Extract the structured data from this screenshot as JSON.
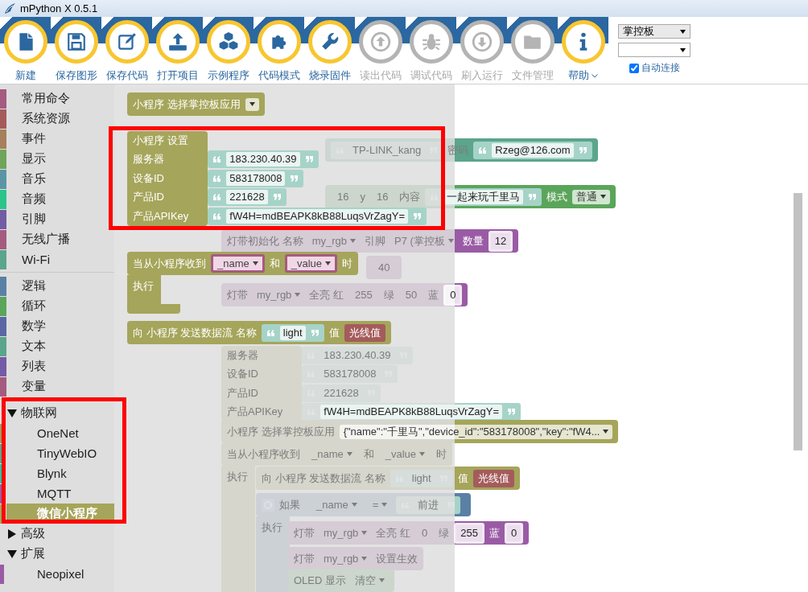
{
  "window": {
    "title": "mPython X 0.5.1"
  },
  "toolbar": {
    "buttons": [
      {
        "label": "新建",
        "disabled": false
      },
      {
        "label": "保存图形",
        "disabled": false
      },
      {
        "label": "保存代码",
        "disabled": false
      },
      {
        "label": "打开项目",
        "disabled": false
      },
      {
        "label": "示例程序",
        "disabled": false
      },
      {
        "label": "代码模式",
        "disabled": false
      },
      {
        "label": "烧录固件",
        "disabled": false
      },
      {
        "label": "读出代码",
        "disabled": true
      },
      {
        "label": "调试代码",
        "disabled": true
      },
      {
        "label": "刷入运行",
        "disabled": true
      },
      {
        "label": "文件管理",
        "disabled": true
      },
      {
        "label": "帮助",
        "disabled": false,
        "menu": true
      }
    ],
    "board_select": {
      "value": "掌控板"
    },
    "auto_connect": {
      "label": "自动连接",
      "checked": true
    }
  },
  "toolbox": {
    "sections": [
      {
        "items": [
          {
            "label": "常用命令",
            "color": "#a55b80",
            "selected": false
          },
          {
            "label": "系统资源",
            "color": "#a55b5b",
            "selected": false
          },
          {
            "label": "事件",
            "color": "#a5805b",
            "selected": false
          },
          {
            "label": "显示",
            "color": "#6fa55b",
            "selected": false
          },
          {
            "label": "音乐",
            "color": "#5b95a5",
            "selected": false
          },
          {
            "label": "音频",
            "color": "#2bc48a",
            "selected": false
          },
          {
            "label": "引脚",
            "color": "#745ba5",
            "selected": false
          },
          {
            "label": "无线广播",
            "color": "#a55b80",
            "selected": false
          },
          {
            "label": "Wi-Fi",
            "color": "#5ba58c",
            "selected": false
          }
        ]
      },
      {
        "items": [
          {
            "label": "逻辑",
            "color": "#5b80a5",
            "selected": false
          },
          {
            "label": "循环",
            "color": "#5ba55b",
            "selected": false
          },
          {
            "label": "数学",
            "color": "#5b67a5",
            "selected": false
          },
          {
            "label": "文本",
            "color": "#5ba58c",
            "selected": false
          },
          {
            "label": "列表",
            "color": "#745ba5",
            "selected": false
          },
          {
            "label": "变量",
            "color": "#a55b80",
            "selected": false
          }
        ]
      }
    ],
    "tree": [
      {
        "label": "物联网",
        "expanded": true,
        "highlighted": true,
        "children": [
          {
            "label": "OneNet",
            "color": "#a5985b",
            "selected": false
          },
          {
            "label": "TinyWebIO",
            "color": "#5ba58c",
            "selected": false
          },
          {
            "label": "Blynk",
            "color": "#2bc4a0",
            "selected": false
          },
          {
            "label": "MQTT",
            "color": "#9a5ba5",
            "selected": false
          },
          {
            "label": "微信小程序",
            "color": "#a5a55b",
            "selected": true
          }
        ]
      },
      {
        "label": "高级",
        "expanded": false,
        "highlighted": false
      },
      {
        "label": "扩展",
        "expanded": true,
        "highlighted": false,
        "children": [
          {
            "label": "Neopixel",
            "color": "#9a5ba5",
            "selected": false
          }
        ]
      }
    ]
  },
  "flyout": {
    "blocks": [
      {
        "kind": "iot",
        "rows": [
          [
            {
              "kind": "label",
              "text": "小程序 选择掌控板应用"
            },
            {
              "kind": "dropdown"
            }
          ]
        ]
      },
      {
        "kind": "iot_settings",
        "highlighted": true,
        "rows": [
          [
            {
              "kind": "label",
              "text": "小程序 设置"
            }
          ],
          [
            {
              "kind": "label",
              "text": "服务器"
            },
            {
              "kind": "string",
              "text": "183.230.40.39"
            }
          ],
          [
            {
              "kind": "label",
              "text": "设备ID"
            },
            {
              "kind": "string",
              "text": "583178008"
            }
          ],
          [
            {
              "kind": "label",
              "text": "产品ID"
            },
            {
              "kind": "string",
              "text": "221628"
            }
          ],
          [
            {
              "kind": "label",
              "text": "产品APIKey"
            },
            {
              "kind": "string",
              "text": "fW4H=mdBEAPK8kB88LuqsVrZagY="
            }
          ]
        ]
      },
      {
        "kind": "iot",
        "highlighted": false,
        "rows": [
          [
            {
              "kind": "label",
              "text": "当从小程序收到"
            },
            {
              "kind": "variable",
              "text": "_name"
            },
            {
              "kind": "label",
              "text": "和"
            },
            {
              "kind": "variable",
              "text": "_value"
            },
            {
              "kind": "label",
              "text": "时"
            }
          ],
          [
            {
              "kind": "label",
              "text": "执行"
            },
            {
              "kind": "statement"
            }
          ]
        ]
      },
      {
        "kind": "iot",
        "highlighted": false,
        "rows": [
          [
            {
              "kind": "label",
              "text": "向 小程序 发送数据流 名称"
            },
            {
              "kind": "string",
              "text": "light"
            },
            {
              "kind": "label",
              "text": "值"
            },
            {
              "kind": "sensor_block",
              "parts": [
                {
                  "kind": "label",
                  "text": "光线值"
                }
              ]
            }
          ]
        ]
      }
    ]
  },
  "workspace": {
    "blocks": [
      {
        "kind": "wifi",
        "rows": [
          [
            {
              "kind": "string",
              "text": "TP-LINK_kang"
            },
            {
              "kind": "label",
              "text": "密码"
            },
            {
              "kind": "string",
              "text": "Rzeg@126.com"
            }
          ]
        ]
      },
      {
        "kind": "display",
        "rows": [
          [
            {
              "kind": "number",
              "text": "16"
            },
            {
              "kind": "label",
              "text": "y"
            },
            {
              "kind": "number",
              "text": "16"
            },
            {
              "kind": "label",
              "text": "内容"
            },
            {
              "kind": "string",
              "text": "一起来玩千里马"
            },
            {
              "kind": "label",
              "text": "模式"
            },
            {
              "kind": "dropdown",
              "text": "普通"
            }
          ]
        ]
      },
      {
        "kind": "rgb",
        "rows": [
          [
            {
              "kind": "label",
              "text": "灯带初始化 名称"
            },
            {
              "kind": "dropdown",
              "text": "my_rgb"
            },
            {
              "kind": "label",
              "text": "引脚"
            },
            {
              "kind": "dropdown",
              "text": "P7 (掌控板"
            },
            {
              "kind": "label",
              "text": "数量"
            },
            {
              "kind": "number",
              "text": "12"
            }
          ]
        ]
      },
      {
        "kind": "rgb",
        "rows": [
          [
            {
              "kind": "number",
              "text": "40"
            }
          ]
        ]
      },
      {
        "kind": "rgb",
        "rows": [
          [
            {
              "kind": "label",
              "text": "灯带"
            },
            {
              "kind": "dropdown",
              "text": "my_rgb"
            },
            {
              "kind": "label",
              "text": "全亮 红"
            },
            {
              "kind": "number",
              "text": "255"
            },
            {
              "kind": "label",
              "text": "绿"
            },
            {
              "kind": "number",
              "text": "50"
            },
            {
              "kind": "label",
              "text": "蓝"
            },
            {
              "kind": "number",
              "text": "0"
            }
          ]
        ]
      },
      {
        "kind": "iot_settings",
        "rows": [
          [
            {
              "kind": "label",
              "text": "服务器"
            },
            {
              "kind": "string",
              "text": "183.230.40.39"
            }
          ],
          [
            {
              "kind": "label",
              "text": "设备ID"
            },
            {
              "kind": "string",
              "text": "583178008"
            }
          ],
          [
            {
              "kind": "label",
              "text": "产品ID"
            },
            {
              "kind": "string",
              "text": "221628"
            }
          ],
          [
            {
              "kind": "label",
              "text": "产品APIKey"
            },
            {
              "kind": "string",
              "text": "fW4H=mdBEAPK8kB88LuqsVrZagY="
            }
          ]
        ]
      },
      {
        "kind": "iot",
        "rows": [
          [
            {
              "kind": "label",
              "text": "小程序 选择掌控板应用"
            },
            {
              "kind": "dropdown",
              "text": "{\"name\":\"千里马\",\"device_id\":\"583178008\",\"key\":\"fW4..."
            }
          ]
        ]
      },
      {
        "kind": "iot",
        "rows": [
          [
            {
              "kind": "label",
              "text": "当从小程序收到"
            },
            {
              "kind": "variable",
              "text": "_name"
            },
            {
              "kind": "label",
              "text": "和"
            },
            {
              "kind": "variable",
              "text": "_value"
            },
            {
              "kind": "label",
              "text": "时"
            }
          ],
          [
            {
              "kind": "label",
              "text": "执行"
            },
            {
              "kind": "statement"
            }
          ]
        ]
      },
      {
        "kind": "iot",
        "rows": [
          [
            {
              "kind": "label",
              "text": "向 小程序 发送数据流 名称"
            },
            {
              "kind": "string",
              "text": "light"
            },
            {
              "kind": "label",
              "text": "值"
            },
            {
              "kind": "sensor_block",
              "parts": [
                {
                  "kind": "label",
                  "text": "光线值"
                }
              ]
            }
          ]
        ]
      },
      {
        "kind": "logic",
        "rows": [
          [
            {
              "kind": "gear"
            },
            {
              "kind": "label",
              "text": "如果"
            },
            {
              "kind": "logic_block",
              "parts": [
                {
                  "kind": "variable",
                  "text": "_name"
                },
                {
                  "kind": "dropdown",
                  "text": "="
                },
                {
                  "kind": "string",
                  "text": "前进"
                }
              ]
            }
          ],
          [
            {
              "kind": "label",
              "text": "执行"
            },
            {
              "kind": "statement"
            }
          ]
        ]
      },
      {
        "kind": "rgb",
        "rows": [
          [
            {
              "kind": "label",
              "text": "灯带"
            },
            {
              "kind": "dropdown",
              "text": "my_rgb"
            },
            {
              "kind": "label",
              "text": "全亮 红"
            },
            {
              "kind": "number",
              "text": "0"
            },
            {
              "kind": "label",
              "text": "绿"
            },
            {
              "kind": "number",
              "text": "255"
            },
            {
              "kind": "label",
              "text": "蓝"
            },
            {
              "kind": "number",
              "text": "0"
            }
          ]
        ]
      },
      {
        "kind": "rgb",
        "rows": [
          [
            {
              "kind": "label",
              "text": "灯带"
            },
            {
              "kind": "dropdown",
              "text": "my_rgb"
            },
            {
              "kind": "label",
              "text": "设置生效"
            }
          ]
        ]
      },
      {
        "kind": "display",
        "rows": [
          [
            {
              "kind": "label",
              "text": "OLED 显示"
            },
            {
              "kind": "dropdown",
              "text": "清空"
            }
          ]
        ]
      }
    ]
  }
}
